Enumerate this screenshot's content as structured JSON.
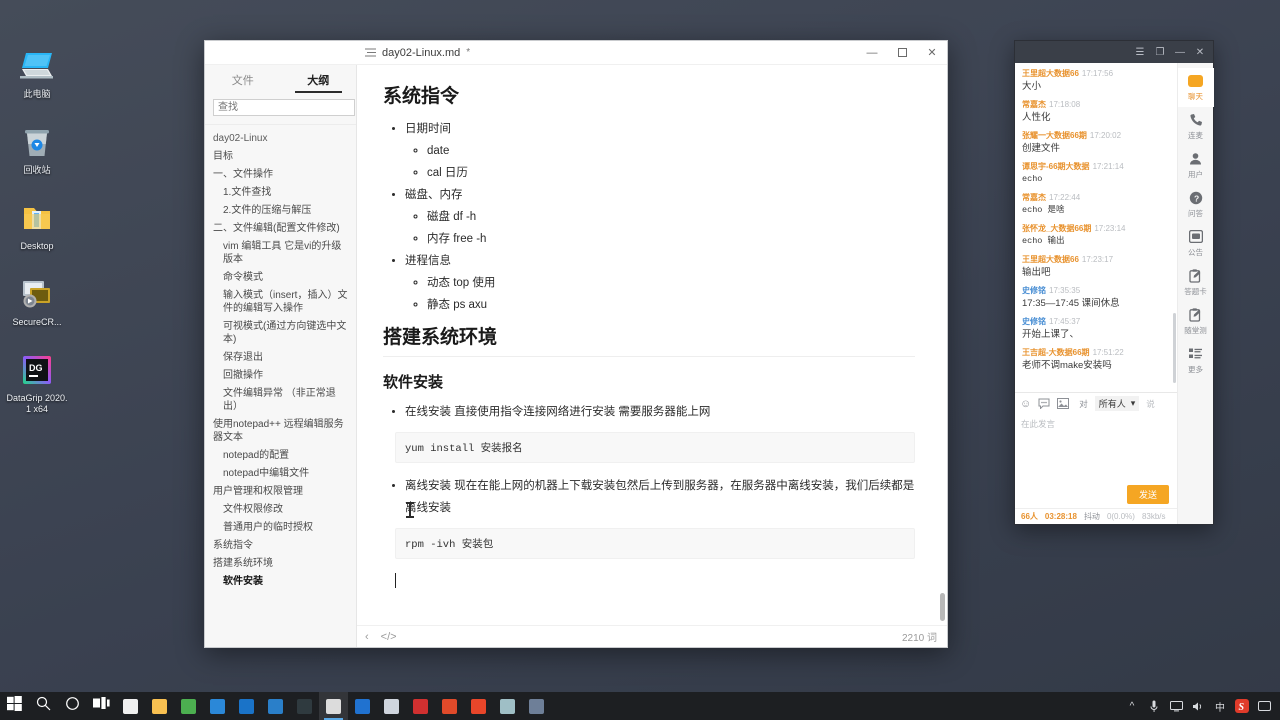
{
  "desktop": {
    "icons": [
      {
        "label": "此电脑",
        "icon": "computer-icon"
      },
      {
        "label": "回收站",
        "icon": "recycle-bin-icon"
      },
      {
        "label": "Desktop",
        "icon": "folder-icon"
      },
      {
        "label": "SecureCR...",
        "icon": "securecrt-icon"
      },
      {
        "label": "DataGrip 2020.1 x64",
        "icon": "datagrip-icon"
      }
    ]
  },
  "taskbar": {
    "items": [
      {
        "name": "start-button",
        "icon": "windows-logo-icon",
        "color": "#ffffff"
      },
      {
        "name": "search-button",
        "icon": "search-icon",
        "color": "#ffffff"
      },
      {
        "name": "cortana-button",
        "icon": "circle-icon",
        "color": "#ffffff"
      },
      {
        "name": "task-view-button",
        "icon": "task-view-icon",
        "color": "#ffffff"
      },
      {
        "name": "app-store",
        "icon": "store-icon",
        "color": "#f0f0f0"
      },
      {
        "name": "file-explorer",
        "icon": "folder-icon",
        "color": "#f8c051"
      },
      {
        "name": "chrome",
        "icon": "chrome-icon",
        "color": "#4caf50"
      },
      {
        "name": "edge",
        "icon": "edge-icon",
        "color": "#2b88d8"
      },
      {
        "name": "app-blue",
        "icon": "app-icon",
        "color": "#1a73c8"
      },
      {
        "name": "vscode",
        "icon": "vscode-icon",
        "color": "#2a7fc9"
      },
      {
        "name": "pycharm",
        "icon": "pycharm-icon",
        "color": "#2f3a3f"
      },
      {
        "name": "typora",
        "icon": "typora-icon",
        "color": "#dcdcdc"
      },
      {
        "name": "app-blue2",
        "icon": "app-icon",
        "color": "#2072d0"
      },
      {
        "name": "app-grey",
        "icon": "app-icon",
        "color": "#cfd5de"
      },
      {
        "name": "app-red",
        "icon": "heart-icon",
        "color": "#d03030"
      },
      {
        "name": "app-orange",
        "icon": "app-icon",
        "color": "#e04a2a"
      },
      {
        "name": "xshell",
        "icon": "xshell-icon",
        "color": "#e8462a"
      },
      {
        "name": "app-teal",
        "icon": "app-icon",
        "color": "#9fbfc6"
      },
      {
        "name": "app-last",
        "icon": "app-icon",
        "color": "#6e7f98"
      }
    ],
    "tray": [
      "^",
      "mic-icon",
      "display-icon",
      "volume-icon",
      "中",
      "sogou-icon",
      "notification-icon"
    ]
  },
  "typora": {
    "document_name": "day02-Linux.md",
    "modified_marker": "*",
    "window_buttons": {
      "minimize": "—",
      "maximize": "▢",
      "close": "✕"
    },
    "sidebar": {
      "tabs": [
        {
          "label": "文件",
          "active": false
        },
        {
          "label": "大纲",
          "active": true
        }
      ],
      "search_placeholder": "查找",
      "search_value": "",
      "clear_label": "✕",
      "outline": [
        {
          "label": "day02-Linux",
          "level": 0,
          "active": false
        },
        {
          "label": "目标",
          "level": 1,
          "active": false
        },
        {
          "label": "一、文件操作",
          "level": 1,
          "active": false
        },
        {
          "label": "1.文件查找",
          "level": 2,
          "active": false
        },
        {
          "label": "2.文件的压缩与解压",
          "level": 2,
          "active": false
        },
        {
          "label": "二、文件编辑(配置文件修改)",
          "level": 1,
          "active": false
        },
        {
          "label": "vim 编辑工具 它是vi的升级版本",
          "level": 2,
          "active": false
        },
        {
          "label": "命令模式",
          "level": 2,
          "active": false
        },
        {
          "label": "输入模式（insert，插入）文件的编辑写入操作",
          "level": 2,
          "active": false
        },
        {
          "label": "可视模式(通过方向键选中文本)",
          "level": 2,
          "active": false
        },
        {
          "label": "保存退出",
          "level": 2,
          "active": false
        },
        {
          "label": "回撤操作",
          "level": 2,
          "active": false
        },
        {
          "label": "文件编辑异常 （非正常退出）",
          "level": 2,
          "active": false
        },
        {
          "label": "使用notepad++ 远程编辑服务器文本",
          "level": 1,
          "active": false
        },
        {
          "label": "notepad的配置",
          "level": 2,
          "active": false
        },
        {
          "label": "notepad中编辑文件",
          "level": 2,
          "active": false
        },
        {
          "label": "用户管理和权限管理",
          "level": 1,
          "active": false
        },
        {
          "label": "文件权限修改",
          "level": 2,
          "active": false
        },
        {
          "label": "普通用户的临时授权",
          "level": 2,
          "active": false
        },
        {
          "label": "系统指令",
          "level": 1,
          "active": false
        },
        {
          "label": "搭建系统环境",
          "level": 1,
          "active": false
        },
        {
          "label": "软件安装",
          "level": 2,
          "active": true
        }
      ]
    },
    "content": {
      "h1_system": "系统指令",
      "list1": [
        {
          "text": "日期时间",
          "children": [
            "date",
            "cal 日历"
          ]
        },
        {
          "text": "磁盘、内存",
          "children": [
            "磁盘  df -h",
            "内存  free -h"
          ]
        },
        {
          "text": "进程信息",
          "children": [
            "动态 top 使用",
            "静态  ps axu"
          ]
        }
      ],
      "h1_env": "搭建系统环境",
      "h2_install": "软件安装",
      "bullet_online": "在线安装 直接使用指令连接网络进行安装 需要服务器能上网",
      "code_yum": "yum install 安装报名",
      "bullet_offline": "离线安装 现在在能上网的机器上下载安装包然后上传到服务器，在服务器中离线安装，我们后续都是离线安装",
      "code_rpm": "rpm -ivh 安装包"
    },
    "statusbar": {
      "collapse_icon": "‹",
      "source_icon": "</>",
      "word_count": "2210 词"
    }
  },
  "chat": {
    "window_buttons": [
      {
        "name": "menu-icon",
        "glyph": "☰"
      },
      {
        "name": "restore-icon",
        "glyph": "❐"
      },
      {
        "name": "minimize-icon",
        "glyph": "—"
      },
      {
        "name": "close-icon",
        "glyph": "✕"
      }
    ],
    "messages": [
      {
        "name": "王里超大数据66",
        "time": "17:17:56",
        "body": "大小",
        "role": "student",
        "mono": false
      },
      {
        "name": "常嘉杰",
        "time": "17:18:08",
        "body": "人性化",
        "role": "student",
        "mono": false
      },
      {
        "name": "张耀一大数据66期",
        "time": "17:20:02",
        "body": "创建文件",
        "role": "student",
        "mono": false
      },
      {
        "name": "谭思宇-66期大数据",
        "time": "17:21:14",
        "body": "echo",
        "role": "student",
        "mono": true
      },
      {
        "name": "常嘉杰",
        "time": "17:22:44",
        "body": "echo  是啥",
        "role": "student",
        "mono": true
      },
      {
        "name": "张怀龙_大数据66期",
        "time": "17:23:14",
        "body": "echo    输出",
        "role": "student",
        "mono": true
      },
      {
        "name": "王里超大数据66",
        "time": "17:23:17",
        "body": "输出吧",
        "role": "student",
        "mono": false
      },
      {
        "name": "史修铭",
        "time": "17:35:35",
        "body": "17:35—17:45   课间休息",
        "role": "teacher",
        "mono": false
      },
      {
        "name": "史修铭",
        "time": "17:45:37",
        "body": "开始上课了、",
        "role": "teacher",
        "mono": false
      },
      {
        "name": "王吉超-大数据66期",
        "time": "17:51:22",
        "body": "老师不调make安装吗",
        "role": "student",
        "mono": false
      }
    ],
    "toolbar": {
      "emoji_icon": "☺",
      "chat_icon": "💬",
      "image_icon": "🖼",
      "to_label": "对",
      "target": "所有人",
      "dropdown_icon": "▾",
      "say_label": "说"
    },
    "input_placeholder": "在此发言",
    "send_label": "发送",
    "status": {
      "people_count": "66人",
      "duration": "03:28:18",
      "delay_label": "抖动",
      "packet_loss": "0(0.0%)",
      "bandwidth": "83kb/s"
    },
    "sidebar": [
      {
        "label": "聊天",
        "icon": "chat-bubble-icon",
        "active": true
      },
      {
        "label": "连麦",
        "icon": "phone-icon",
        "active": false
      },
      {
        "label": "用户",
        "icon": "user-icon",
        "active": false
      },
      {
        "label": "问答",
        "icon": "question-icon",
        "active": false
      },
      {
        "label": "公告",
        "icon": "announcement-icon",
        "active": false
      },
      {
        "label": "答题卡",
        "icon": "answer-card-icon",
        "active": false
      },
      {
        "label": "随堂测",
        "icon": "quiz-icon",
        "active": false
      },
      {
        "label": "更多",
        "icon": "more-icon",
        "active": false
      }
    ]
  }
}
